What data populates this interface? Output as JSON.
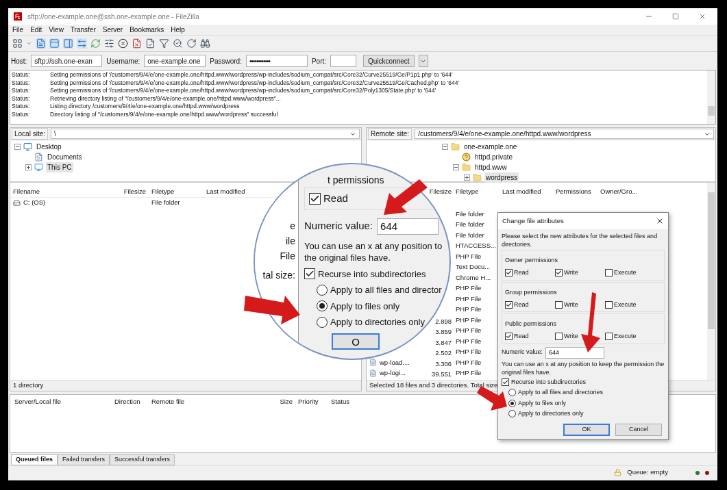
{
  "window": {
    "title": "sftp://one-example.one@ssh.one-example.one - FileZilla"
  },
  "menu": [
    "File",
    "Edit",
    "View",
    "Transfer",
    "Server",
    "Bookmarks",
    "Help"
  ],
  "quickconnect": {
    "fields": [
      {
        "label": "Host:",
        "value": "sftp://ssh.one-exan",
        "kind": "text"
      },
      {
        "label": "Username:",
        "value": "one-example.one",
        "kind": "text"
      },
      {
        "label": "Password:",
        "value": "••••••••••••",
        "kind": "password"
      },
      {
        "label": "Port:",
        "kind": "text"
      }
    ],
    "button": "Quickconnect"
  },
  "log": [
    {
      "label": "Status:",
      "message": "Setting permissions of '/customers/9/4/e/one-example.one/httpd.www/wordpress/wp-includes/sodium_compat/src/Core32/Curve25519/Ge/P1p1.php' to '644'"
    },
    {
      "label": "Status:",
      "message": "Setting permissions of '/customers/9/4/e/one-example.one/httpd.www/wordpress/wp-includes/sodium_compat/src/Core32/Curve25519/Ge/Cached.php' to '644'"
    },
    {
      "label": "Status:",
      "message": "Setting permissions of '/customers/9/4/e/one-example.one/httpd.www/wordpress/wp-includes/sodium_compat/src/Core32/Poly1305/State.php' to '644'"
    },
    {
      "label": "Status:",
      "message": "Retrieving directory listing of \"/customers/9/4/e/one-example.one/httpd.www/wordpress\"..."
    },
    {
      "label": "Status:",
      "message": "Listing directory /customers/9/4/e/one-example.one/httpd.www/wordpress"
    },
    {
      "label": "Status:",
      "message": "Directory listing of \"/customers/9/4/e/one-example.one/httpd.www/wordpress\" successful"
    }
  ],
  "local": {
    "site_label": "Local site:",
    "path": "\\",
    "tree": [
      {
        "label": "Desktop",
        "kind": "desktop",
        "expanded": true,
        "selected": false,
        "children": [
          {
            "label": "Documents",
            "kind": "document",
            "selected": false
          },
          {
            "label": "This PC",
            "kind": "pc",
            "expanded": false,
            "selected": true
          }
        ]
      }
    ],
    "columns": [
      "Filename",
      "Filesize",
      "Filetype",
      "Last modified"
    ],
    "rows": [
      {
        "filename": "C: (OS)",
        "filetype": "File folder"
      }
    ],
    "status": "1 directory"
  },
  "remote": {
    "site_label": "Remote site:",
    "path": "/customers/9/4/e/one-example.one/httpd.www/wordpress",
    "tree": [
      {
        "label": "one-example.one",
        "kind": "folder",
        "expanded": true,
        "selected": false,
        "children": [
          {
            "label": "httpd.private",
            "kind": "unknown",
            "selected": false
          },
          {
            "label": "httpd.www",
            "kind": "folder",
            "expanded": true,
            "selected": false,
            "children": [
              {
                "label": "wordpress",
                "kind": "folder",
                "expanded": false,
                "selected": true
              }
            ]
          }
        ]
      }
    ],
    "columns": [
      "Filesize",
      "Filetype",
      "Last modified",
      "Permissions",
      "Owner/Gro..."
    ],
    "rows": [
      {
        "filetype": "File folder"
      },
      {
        "filetype": "File folder"
      },
      {
        "filetype": "File folder"
      },
      {
        "filetype": "HTACCESS..."
      },
      {
        "filetype": "PHP File"
      },
      {
        "filetype": "Text Docu..."
      },
      {
        "filetype": "Chrome H..."
      },
      {
        "filetype": "PHP File"
      },
      {
        "filetype": "PHP File"
      },
      {
        "filetype": "PHP File"
      },
      {
        "filesize": "2.898",
        "filetype": "PHP File"
      },
      {
        "filesize": "3.859",
        "filetype": "PHP File"
      },
      {
        "filesize": "3.847",
        "filetype": "PHP File"
      },
      {
        "filesize": "2.502",
        "filetype": "PHP File"
      },
      {
        "filename": "wp-load....",
        "filesize": "3.306",
        "filetype": "PHP File"
      },
      {
        "filename": "wp-logi...",
        "filesize": "39.551",
        "filetype": "PHP File"
      }
    ],
    "status": "Selected 18 files and 3 directories. Total size:"
  },
  "queue": {
    "columns": [
      "Server/Local file",
      "Direction",
      "Remote file",
      "Size",
      "Priority",
      "Status"
    ],
    "tabs": [
      {
        "label": "Queued files",
        "selected": true
      },
      {
        "label": "Failed transfers",
        "selected": false
      },
      {
        "label": "Successful transfers",
        "selected": false
      }
    ],
    "status": "Queue: empty"
  },
  "dialog": {
    "title": "Change file attributes",
    "intro": "Please select the new attributes for the selected files and directories.",
    "groups": [
      {
        "title": "Owner permissions",
        "perms": [
          {
            "label": "Read",
            "checked": true
          },
          {
            "label": "Write",
            "checked": true
          },
          {
            "label": "Execute",
            "checked": false
          }
        ]
      },
      {
        "title": "Group permissions",
        "perms": [
          {
            "label": "Read",
            "checked": true
          },
          {
            "label": "Write",
            "checked": false
          },
          {
            "label": "Execute",
            "checked": false
          }
        ]
      },
      {
        "title": "Public permissions",
        "perms": [
          {
            "label": "Read",
            "checked": true
          },
          {
            "label": "Write",
            "checked": false
          },
          {
            "label": "Execute",
            "checked": false
          }
        ]
      }
    ],
    "numeric_label": "Numeric value:",
    "numeric_value": "644",
    "hint": "You can use an x at any position to keep the permission the original files have.",
    "recurse": {
      "label": "Recurse into subdirectories",
      "checked": true
    },
    "options": [
      {
        "label": "Apply to all files and directories",
        "selected": false
      },
      {
        "label": "Apply to files only",
        "selected": true
      },
      {
        "label": "Apply to directories only",
        "selected": false
      }
    ],
    "buttons": [
      {
        "label": "OK",
        "default": true
      },
      {
        "label": "Cancel",
        "default": false
      }
    ]
  },
  "magnifier": {
    "background_texts": [
      "e",
      "ile",
      "File",
      "tal size:"
    ],
    "heading": "t permissions",
    "perms": [
      {
        "label": "Read",
        "checked": true
      }
    ],
    "numeric_label": "Numeric value:",
    "numeric_value": "644",
    "hint_lines": [
      "You can use an x at any position to",
      "the original files have."
    ],
    "recurse": {
      "label": "Recurse into subdirectories",
      "checked": true
    },
    "options": [
      {
        "label": "Apply to all files and director",
        "selected": false
      },
      {
        "label": "Apply to files only",
        "selected": true
      },
      {
        "label": "Apply to directories only",
        "selected": false
      }
    ],
    "button": "O"
  }
}
